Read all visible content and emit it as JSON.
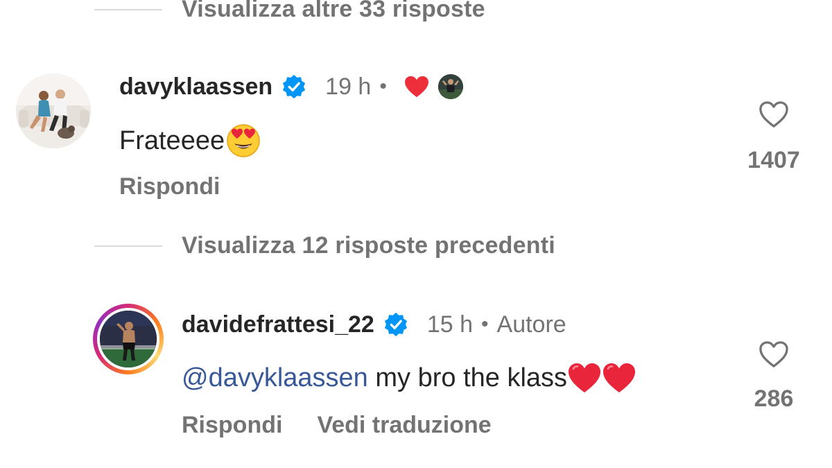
{
  "thread": {
    "view_more_replies": "Visualizza altre 33 risposte",
    "view_previous_replies": "Visualizza 12 risposte precedenti"
  },
  "comments": [
    {
      "username": "davyklaassen",
      "verified": true,
      "time": "19 h",
      "separator": "•",
      "liked_by_author": true,
      "text": "Frateeee",
      "emoji": "smiling-face-with-heart-eyes",
      "like_count": "1407",
      "actions": {
        "reply": "Rispondi"
      }
    },
    {
      "username": "davidefrattesi_22",
      "verified": true,
      "time": "15 h",
      "separator": "•",
      "author_badge": "Autore",
      "mention": "@davyklaassen",
      "text": " my bro the klass",
      "emoji": "red-heart x2",
      "like_count": "286",
      "actions": {
        "reply": "Rispondi",
        "translate": "Vedi traduzione"
      }
    }
  ],
  "colors": {
    "primary_text": "#262626",
    "secondary_text": "#737373",
    "mention": "#385898",
    "verified_blue": "#0095f6",
    "heart_red": "#ed2f3b",
    "divider": "#dbdbdb"
  },
  "icons": [
    "verified-badge-icon",
    "red-heart-icon",
    "heart-outline-icon",
    "heart-eyes-emoji-icon"
  ]
}
